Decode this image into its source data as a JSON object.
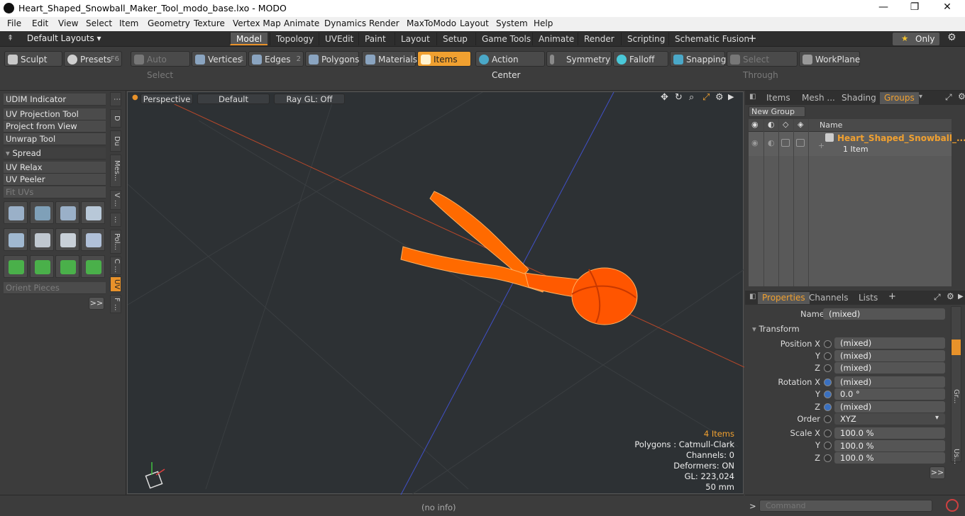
{
  "window": {
    "title": "Heart_Shaped_Snowball_Maker_Tool_modo_base.lxo - MODO",
    "minimize": "—",
    "maximize": "❐",
    "close": "✕"
  },
  "menu": [
    "File",
    "Edit",
    "View",
    "Select",
    "Item",
    "Geometry",
    "Texture",
    "Vertex Map",
    "Animate",
    "Dynamics",
    "Render",
    "MaxToModo",
    "Layout",
    "System",
    "Help"
  ],
  "layouts": {
    "label": "Default Layouts ▾",
    "tabs": [
      "Model",
      "Topology",
      "UVEdit",
      "Paint",
      "Layout",
      "Setup",
      "Game Tools",
      "Animate",
      "Render",
      "Scripting",
      "Schematic Fusion"
    ],
    "active": "Model",
    "add": "+",
    "only_label": "Only"
  },
  "toolbar": {
    "sculpt": "Sculpt",
    "presets": "Presets",
    "presets_key": "F6",
    "auto_select": "Auto Select",
    "vertices": "Vertices",
    "vertices_num": "1",
    "edges": "Edges",
    "edges_num": "2",
    "polygons": "Polygons",
    "materials": "Materials",
    "items": "Items",
    "action_center": "Action Center",
    "symmetry": "Symmetry",
    "falloff": "Falloff",
    "snapping": "Snapping",
    "select_through": "Select Through",
    "workplane": "WorkPlane"
  },
  "left_panel": {
    "buttons": [
      "UDIM Indicator",
      "UV Projection Tool",
      "Project from View",
      "Unwrap Tool"
    ],
    "spread": "Spread",
    "buttons2": [
      "UV Relax",
      "UV Peeler"
    ],
    "fit_uvs": "Fit UVs",
    "orient": "Orient Pieces",
    "more": ">>",
    "vtabs": [
      "D",
      "Du",
      "Mes...",
      "V ...",
      "...",
      "Pol...",
      "C ...",
      "UV",
      "F ..."
    ]
  },
  "viewport": {
    "perspective": "Perspective",
    "default": "Default",
    "raygl": "Ray GL: Off",
    "stats": {
      "items": "4 Items",
      "polygons": "Polygons : Catmull-Clark",
      "channels": "Channels: 0",
      "deformers": "Deformers: ON",
      "gl": "GL: 223,024",
      "size": "50 mm"
    }
  },
  "status": {
    "info": "(no info)"
  },
  "groups_panel": {
    "tabs": [
      "Items",
      "Mesh ...",
      "Shading",
      "Groups"
    ],
    "active": "Groups",
    "new_group": "New Group",
    "name_col": "Name",
    "group_name": "Heart_Shaped_Snowball_...",
    "group_count": "1 Item"
  },
  "properties_panel": {
    "tabs": [
      "Properties",
      "Channels",
      "Lists"
    ],
    "active": "Properties",
    "add": "+",
    "name_label": "Name",
    "name_value": "(mixed)",
    "transform": "Transform",
    "rows": [
      {
        "label": "Position X",
        "value": "(mixed)"
      },
      {
        "label": "Y",
        "value": "(mixed)"
      },
      {
        "label": "Z",
        "value": "(mixed)"
      },
      {
        "label": "Rotation X",
        "value": "(mixed)"
      },
      {
        "label": "Y",
        "value": "0.0 °"
      },
      {
        "label": "Z",
        "value": "(mixed)"
      },
      {
        "label": "Order",
        "value": "XYZ"
      },
      {
        "label": "Scale X",
        "value": "100.0 %"
      },
      {
        "label": "Y",
        "value": "100.0 %"
      },
      {
        "label": "Z",
        "value": "100.0 %"
      }
    ],
    "side_tabs": [
      "Gr...",
      "Us..."
    ],
    "more": ">>"
  },
  "command": {
    "placeholder": "Command",
    "prompt": ">"
  },
  "colors": {
    "accent": "#f0a030",
    "mesh": "#ff6a00",
    "viewport_bg": "#2d3134"
  }
}
